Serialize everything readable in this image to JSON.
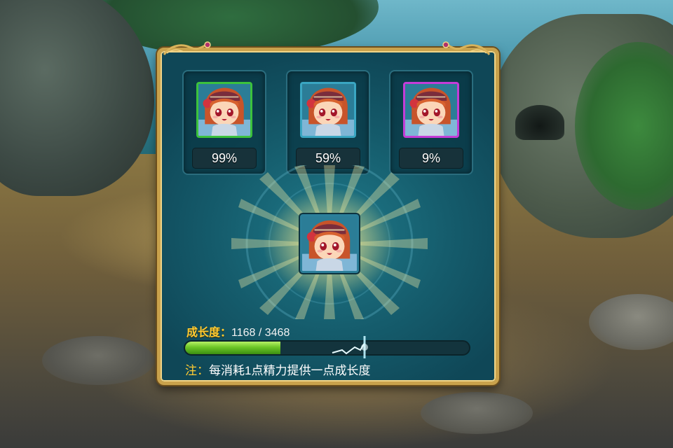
{
  "candidates": [
    {
      "percent": "99%",
      "frame_color": "#3cc23c"
    },
    {
      "percent": "59%",
      "frame_color": "#3aa6c2"
    },
    {
      "percent": "9%",
      "frame_color": "#c43cd8"
    }
  ],
  "growth": {
    "label": "成长度：",
    "value": "1168 / 3468",
    "current": 1168,
    "max": 3468
  },
  "note": {
    "prefix": "注：",
    "text": "每消耗1点精力提供一点成长度"
  },
  "colors": {
    "panel_border": "#c9a24c",
    "panel_bg": "#155c6c",
    "label_gold": "#ffcc33",
    "bar_green": "#6cc626"
  }
}
